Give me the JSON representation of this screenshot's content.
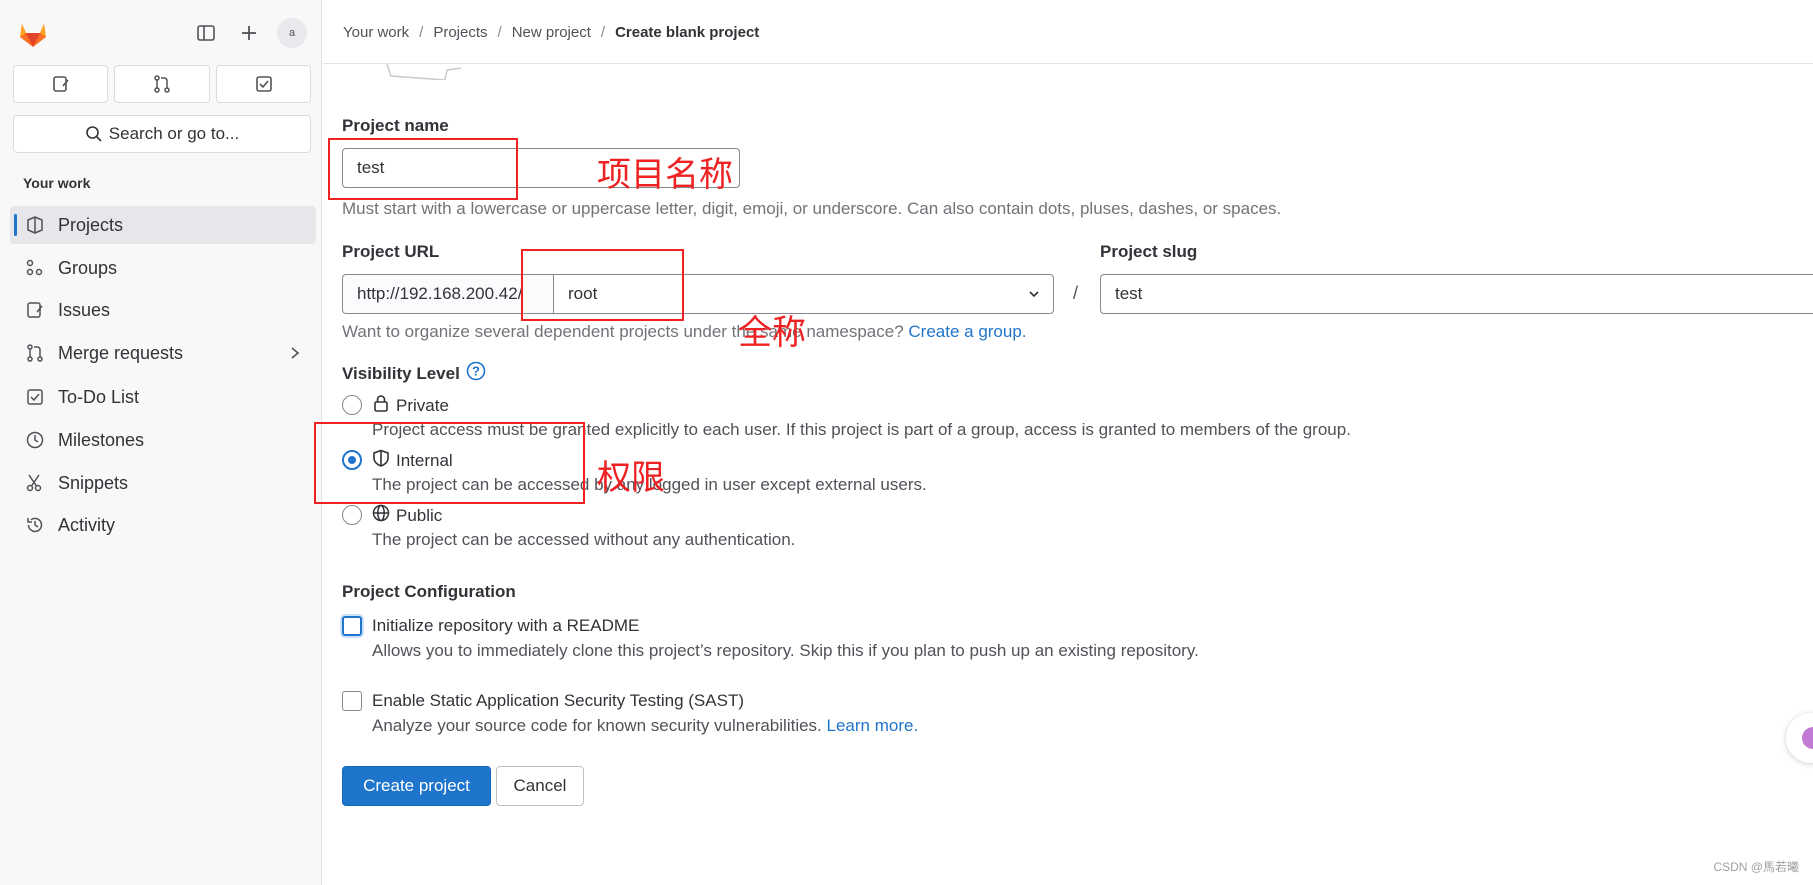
{
  "sidebar": {
    "quick_actions": [
      "issues-icon",
      "merge-request-icon",
      "todo-icon"
    ],
    "search_label": "Search or go to...",
    "section_title": "Your work",
    "items": [
      {
        "label": "Projects",
        "icon": "project-icon"
      },
      {
        "label": "Groups",
        "icon": "group-icon"
      },
      {
        "label": "Issues",
        "icon": "issues-icon"
      },
      {
        "label": "Merge requests",
        "icon": "merge-request-icon"
      },
      {
        "label": "To-Do List",
        "icon": "todo-icon"
      },
      {
        "label": "Milestones",
        "icon": "clock-icon"
      },
      {
        "label": "Snippets",
        "icon": "scissors-icon"
      },
      {
        "label": "Activity",
        "icon": "history-icon"
      }
    ],
    "avatar_alt": "a"
  },
  "breadcrumb": [
    "Your work",
    "Projects",
    "New project",
    "Create blank project"
  ],
  "form": {
    "project_name_label": "Project name",
    "project_name_value": "test",
    "project_name_help": "Must start with a lowercase or uppercase letter, digit, emoji, or underscore. Can also contain dots, pluses, dashes, or spaces.",
    "project_url_label": "Project URL",
    "url_prefix": "http://192.168.200.42/",
    "namespace_value": "root",
    "slash": "/",
    "project_slug_label": "Project slug",
    "project_slug_value": "test",
    "namespace_help": "Want to organize several dependent projects under the same namespace?",
    "namespace_help_link": "Create a group.",
    "visibility_label": "Visibility Level",
    "visibility_options": [
      {
        "label": "Private",
        "desc": "Project access must be granted explicitly to each user. If this project is part of a group, access is granted to members of the group.",
        "checked": false,
        "icon": "lock-icon"
      },
      {
        "label": "Internal",
        "desc": "The project can be accessed by any logged in user except external users.",
        "checked": true,
        "icon": "shield-icon"
      },
      {
        "label": "Public",
        "desc": "The project can be accessed without any authentication.",
        "checked": false,
        "icon": "globe-icon"
      }
    ],
    "config_label": "Project Configuration",
    "readme_label": "Initialize repository with a README",
    "readme_desc": "Allows you to immediately clone this project’s repository. Skip this if you plan to push up an existing repository.",
    "sast_label": "Enable Static Application Security Testing (SAST)",
    "sast_desc": "Analyze your source code for known security vulnerabilities.",
    "sast_link": "Learn more.",
    "create_button": "Create project",
    "cancel_button": "Cancel"
  },
  "annotations": {
    "name_note": "项目名称",
    "url_note": "全称",
    "visibility_note": "权限"
  },
  "watermark": "CSDN @馬若曦",
  "colors": {
    "accent": "#1f75cb",
    "annotation": "#ee2222",
    "logo": "#fc6d26"
  }
}
